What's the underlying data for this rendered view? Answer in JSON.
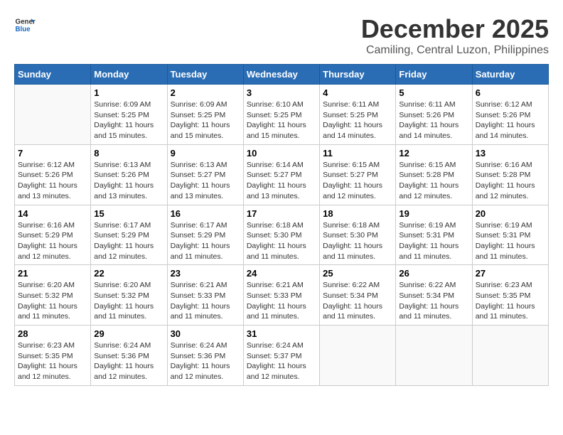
{
  "header": {
    "logo_line1": "General",
    "logo_line2": "Blue",
    "month": "December 2025",
    "location": "Camiling, Central Luzon, Philippines"
  },
  "weekdays": [
    "Sunday",
    "Monday",
    "Tuesday",
    "Wednesday",
    "Thursday",
    "Friday",
    "Saturday"
  ],
  "weeks": [
    [
      {
        "day": "",
        "sunrise": "",
        "sunset": "",
        "daylight": ""
      },
      {
        "day": "1",
        "sunrise": "Sunrise: 6:09 AM",
        "sunset": "Sunset: 5:25 PM",
        "daylight": "Daylight: 11 hours and 15 minutes."
      },
      {
        "day": "2",
        "sunrise": "Sunrise: 6:09 AM",
        "sunset": "Sunset: 5:25 PM",
        "daylight": "Daylight: 11 hours and 15 minutes."
      },
      {
        "day": "3",
        "sunrise": "Sunrise: 6:10 AM",
        "sunset": "Sunset: 5:25 PM",
        "daylight": "Daylight: 11 hours and 15 minutes."
      },
      {
        "day": "4",
        "sunrise": "Sunrise: 6:11 AM",
        "sunset": "Sunset: 5:25 PM",
        "daylight": "Daylight: 11 hours and 14 minutes."
      },
      {
        "day": "5",
        "sunrise": "Sunrise: 6:11 AM",
        "sunset": "Sunset: 5:26 PM",
        "daylight": "Daylight: 11 hours and 14 minutes."
      },
      {
        "day": "6",
        "sunrise": "Sunrise: 6:12 AM",
        "sunset": "Sunset: 5:26 PM",
        "daylight": "Daylight: 11 hours and 14 minutes."
      }
    ],
    [
      {
        "day": "7",
        "sunrise": "Sunrise: 6:12 AM",
        "sunset": "Sunset: 5:26 PM",
        "daylight": "Daylight: 11 hours and 13 minutes."
      },
      {
        "day": "8",
        "sunrise": "Sunrise: 6:13 AM",
        "sunset": "Sunset: 5:26 PM",
        "daylight": "Daylight: 11 hours and 13 minutes."
      },
      {
        "day": "9",
        "sunrise": "Sunrise: 6:13 AM",
        "sunset": "Sunset: 5:27 PM",
        "daylight": "Daylight: 11 hours and 13 minutes."
      },
      {
        "day": "10",
        "sunrise": "Sunrise: 6:14 AM",
        "sunset": "Sunset: 5:27 PM",
        "daylight": "Daylight: 11 hours and 13 minutes."
      },
      {
        "day": "11",
        "sunrise": "Sunrise: 6:15 AM",
        "sunset": "Sunset: 5:27 PM",
        "daylight": "Daylight: 11 hours and 12 minutes."
      },
      {
        "day": "12",
        "sunrise": "Sunrise: 6:15 AM",
        "sunset": "Sunset: 5:28 PM",
        "daylight": "Daylight: 11 hours and 12 minutes."
      },
      {
        "day": "13",
        "sunrise": "Sunrise: 6:16 AM",
        "sunset": "Sunset: 5:28 PM",
        "daylight": "Daylight: 11 hours and 12 minutes."
      }
    ],
    [
      {
        "day": "14",
        "sunrise": "Sunrise: 6:16 AM",
        "sunset": "Sunset: 5:29 PM",
        "daylight": "Daylight: 11 hours and 12 minutes."
      },
      {
        "day": "15",
        "sunrise": "Sunrise: 6:17 AM",
        "sunset": "Sunset: 5:29 PM",
        "daylight": "Daylight: 11 hours and 12 minutes."
      },
      {
        "day": "16",
        "sunrise": "Sunrise: 6:17 AM",
        "sunset": "Sunset: 5:29 PM",
        "daylight": "Daylight: 11 hours and 11 minutes."
      },
      {
        "day": "17",
        "sunrise": "Sunrise: 6:18 AM",
        "sunset": "Sunset: 5:30 PM",
        "daylight": "Daylight: 11 hours and 11 minutes."
      },
      {
        "day": "18",
        "sunrise": "Sunrise: 6:18 AM",
        "sunset": "Sunset: 5:30 PM",
        "daylight": "Daylight: 11 hours and 11 minutes."
      },
      {
        "day": "19",
        "sunrise": "Sunrise: 6:19 AM",
        "sunset": "Sunset: 5:31 PM",
        "daylight": "Daylight: 11 hours and 11 minutes."
      },
      {
        "day": "20",
        "sunrise": "Sunrise: 6:19 AM",
        "sunset": "Sunset: 5:31 PM",
        "daylight": "Daylight: 11 hours and 11 minutes."
      }
    ],
    [
      {
        "day": "21",
        "sunrise": "Sunrise: 6:20 AM",
        "sunset": "Sunset: 5:32 PM",
        "daylight": "Daylight: 11 hours and 11 minutes."
      },
      {
        "day": "22",
        "sunrise": "Sunrise: 6:20 AM",
        "sunset": "Sunset: 5:32 PM",
        "daylight": "Daylight: 11 hours and 11 minutes."
      },
      {
        "day": "23",
        "sunrise": "Sunrise: 6:21 AM",
        "sunset": "Sunset: 5:33 PM",
        "daylight": "Daylight: 11 hours and 11 minutes."
      },
      {
        "day": "24",
        "sunrise": "Sunrise: 6:21 AM",
        "sunset": "Sunset: 5:33 PM",
        "daylight": "Daylight: 11 hours and 11 minutes."
      },
      {
        "day": "25",
        "sunrise": "Sunrise: 6:22 AM",
        "sunset": "Sunset: 5:34 PM",
        "daylight": "Daylight: 11 hours and 11 minutes."
      },
      {
        "day": "26",
        "sunrise": "Sunrise: 6:22 AM",
        "sunset": "Sunset: 5:34 PM",
        "daylight": "Daylight: 11 hours and 11 minutes."
      },
      {
        "day": "27",
        "sunrise": "Sunrise: 6:23 AM",
        "sunset": "Sunset: 5:35 PM",
        "daylight": "Daylight: 11 hours and 11 minutes."
      }
    ],
    [
      {
        "day": "28",
        "sunrise": "Sunrise: 6:23 AM",
        "sunset": "Sunset: 5:35 PM",
        "daylight": "Daylight: 11 hours and 12 minutes."
      },
      {
        "day": "29",
        "sunrise": "Sunrise: 6:24 AM",
        "sunset": "Sunset: 5:36 PM",
        "daylight": "Daylight: 11 hours and 12 minutes."
      },
      {
        "day": "30",
        "sunrise": "Sunrise: 6:24 AM",
        "sunset": "Sunset: 5:36 PM",
        "daylight": "Daylight: 11 hours and 12 minutes."
      },
      {
        "day": "31",
        "sunrise": "Sunrise: 6:24 AM",
        "sunset": "Sunset: 5:37 PM",
        "daylight": "Daylight: 11 hours and 12 minutes."
      },
      {
        "day": "",
        "sunrise": "",
        "sunset": "",
        "daylight": ""
      },
      {
        "day": "",
        "sunrise": "",
        "sunset": "",
        "daylight": ""
      },
      {
        "day": "",
        "sunrise": "",
        "sunset": "",
        "daylight": ""
      }
    ]
  ]
}
